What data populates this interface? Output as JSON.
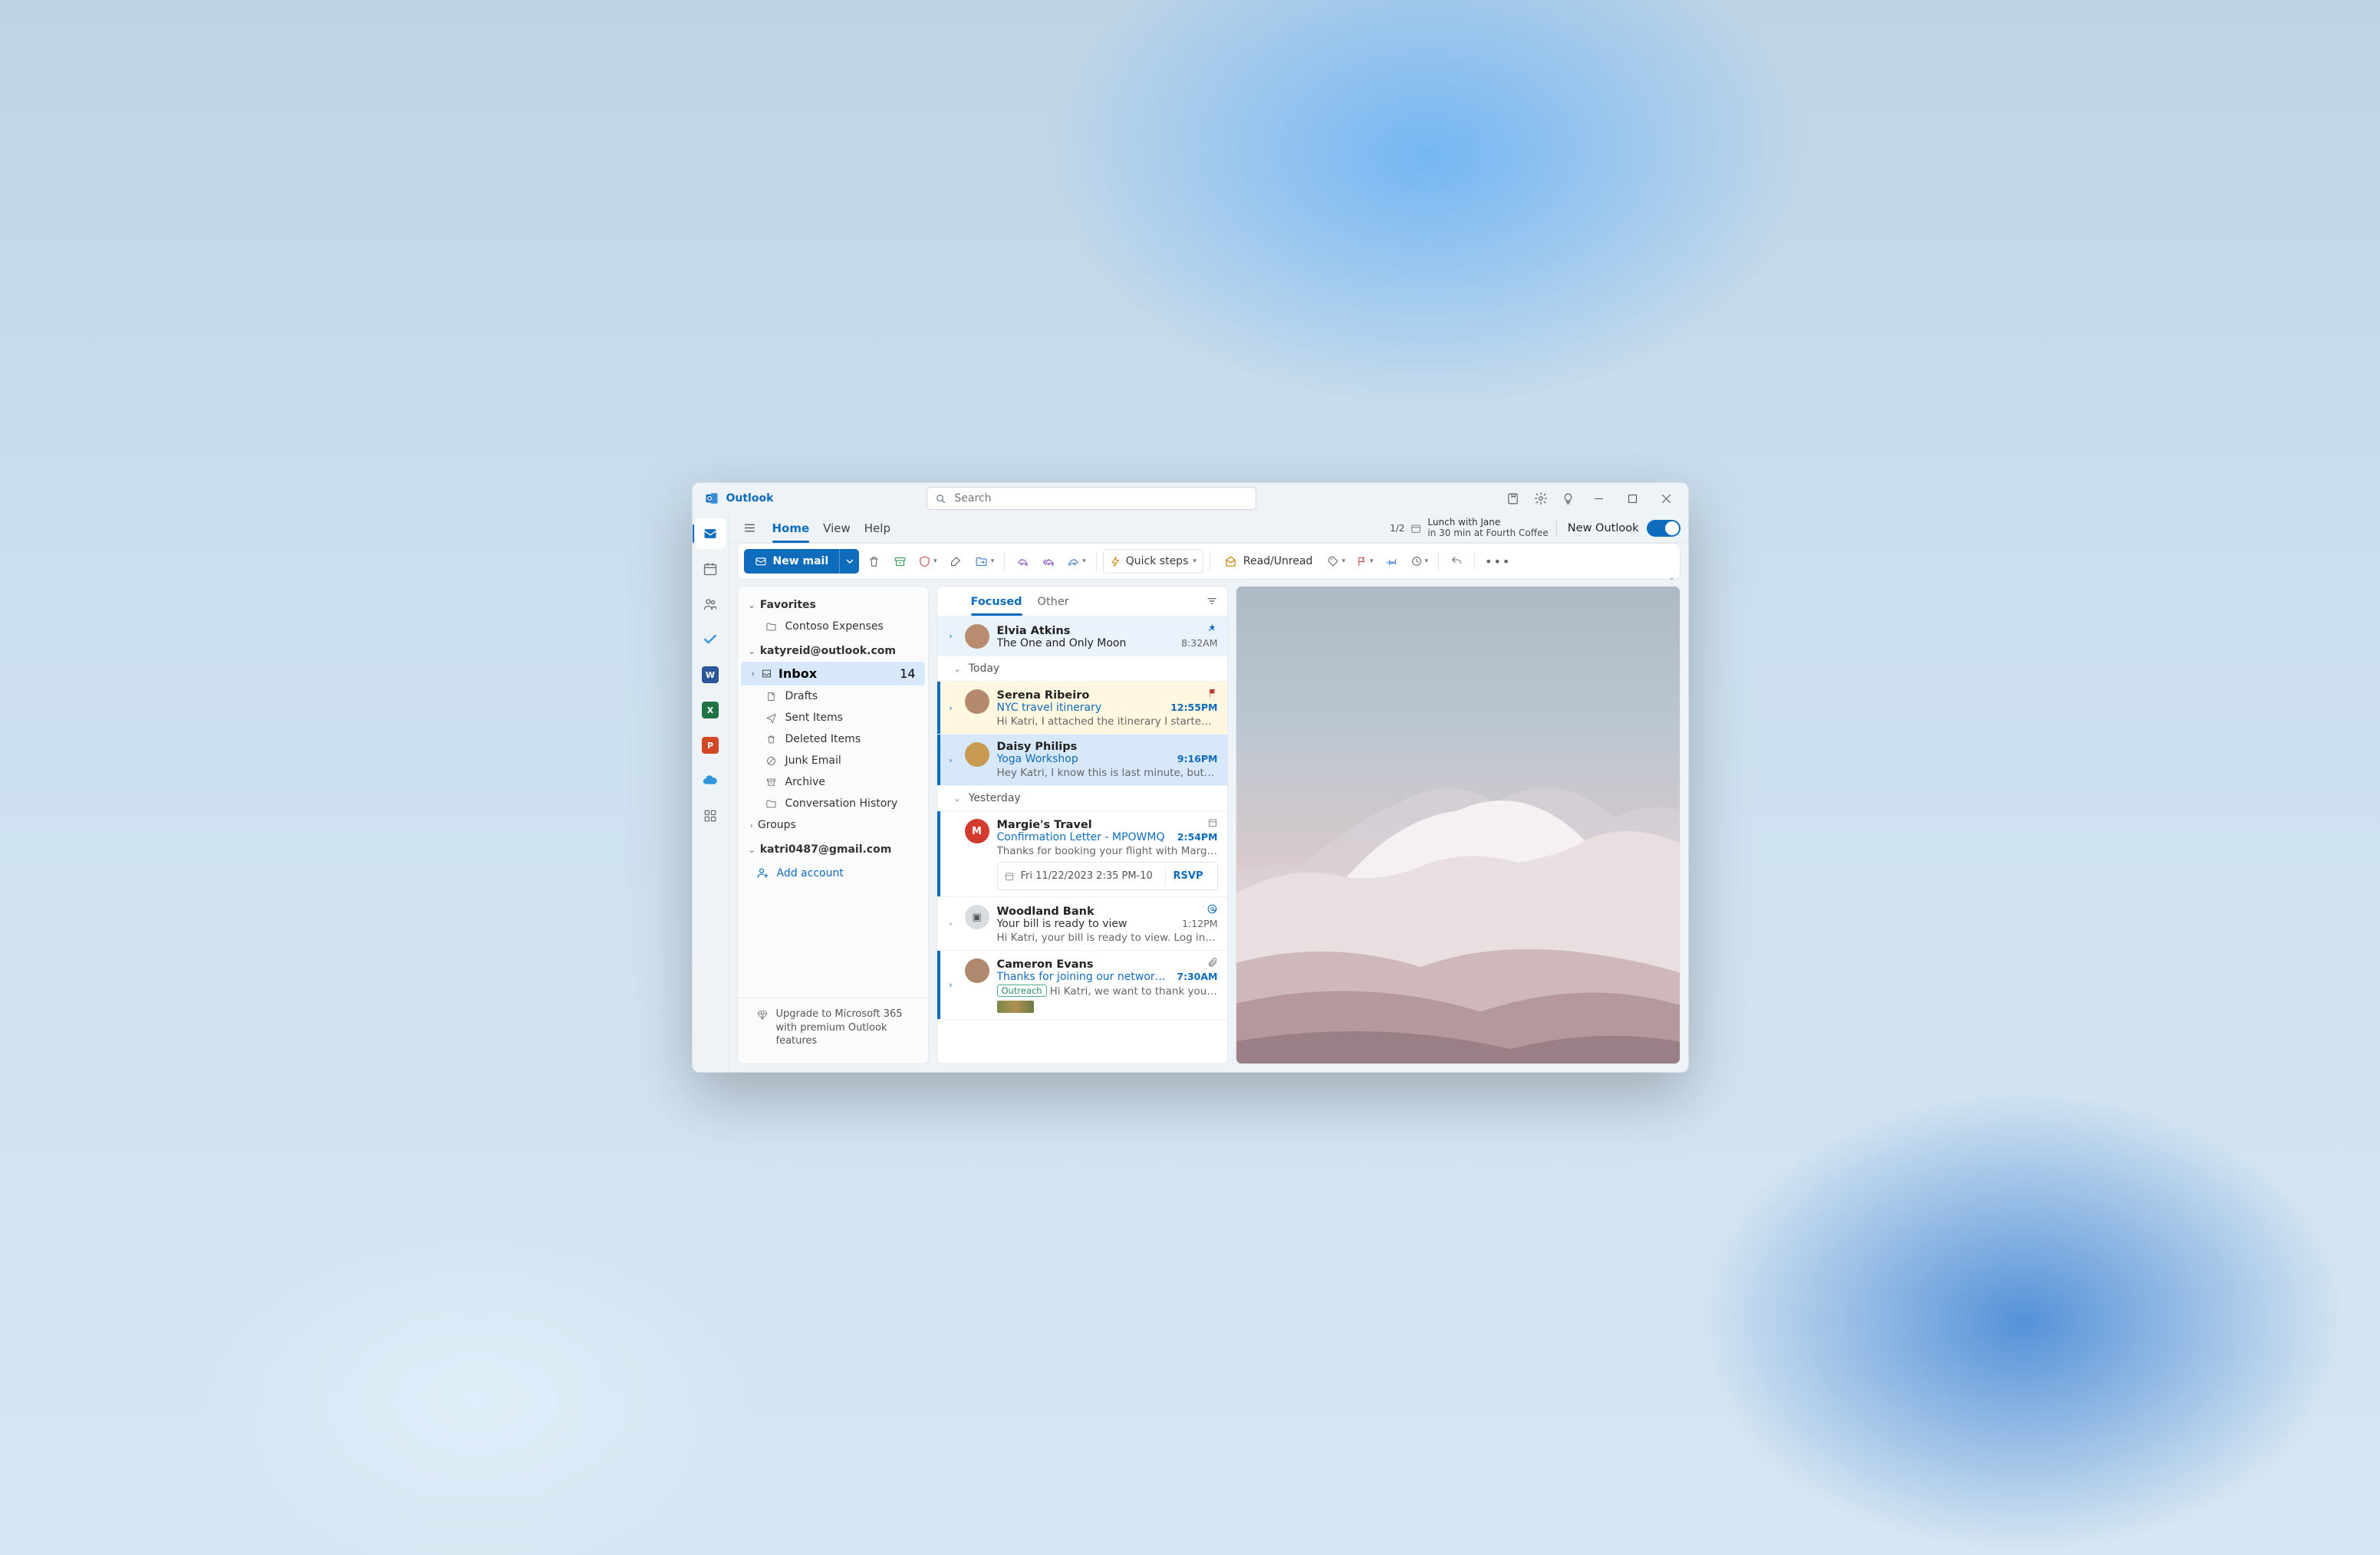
{
  "app": {
    "name": "Outlook"
  },
  "search": {
    "placeholder": "Search"
  },
  "menu": {
    "tabs": [
      "Home",
      "View",
      "Help"
    ],
    "active": 0
  },
  "reminder": {
    "count": "1/2",
    "title": "Lunch with Jane",
    "sub": "in 30 min at Fourth Coffee"
  },
  "newOutlook": {
    "label": "New Outlook",
    "on": true
  },
  "ribbon": {
    "newMail": "New mail",
    "quickSteps": "Quick steps",
    "readUnread": "Read/Unread"
  },
  "folders": {
    "favorites": {
      "label": "Favorites",
      "items": [
        {
          "name": "Contoso Expenses",
          "icon": "folder"
        }
      ]
    },
    "accounts": [
      {
        "email": "katyreid@outlook.com",
        "expanded": true,
        "items": [
          {
            "name": "Inbox",
            "icon": "inbox",
            "count": 14,
            "selected": true,
            "expandable": true
          },
          {
            "name": "Drafts",
            "icon": "draft"
          },
          {
            "name": "Sent Items",
            "icon": "sent"
          },
          {
            "name": "Deleted Items",
            "icon": "trash"
          },
          {
            "name": "Junk Email",
            "icon": "junk"
          },
          {
            "name": "Archive",
            "icon": "archive"
          },
          {
            "name": "Conversation History",
            "icon": "folder"
          }
        ],
        "groups": {
          "label": "Groups"
        }
      },
      {
        "email": "katri0487@gmail.com",
        "expanded": true,
        "items": []
      }
    ],
    "addAccount": "Add account",
    "upgrade": "Upgrade to Microsoft 365 with premium Outlook features"
  },
  "messageList": {
    "tabs": {
      "focused": "Focused",
      "other": "Other",
      "active": "focused"
    },
    "pinned": [
      {
        "from": "Elvia Atkins",
        "subject": "The One and Only Moon",
        "time": "8:32AM",
        "avatar": "#b98c6f"
      }
    ],
    "groups": [
      {
        "label": "Today",
        "items": [
          {
            "from": "Serena Ribeiro",
            "subject": "NYC travel itinerary",
            "time": "12:55PM",
            "preview": "Hi Katri, I attached the itinerary I started fo…",
            "unread": true,
            "flagged": true,
            "avatar": "#b48a6f",
            "expandable": true
          },
          {
            "from": "Daisy Philips",
            "subject": "Yoga Workshop",
            "time": "9:16PM",
            "preview": "Hey Katri, I know this is last minute, but do…",
            "unread": true,
            "selected": true,
            "avatar": "#c89a52",
            "expandable": true
          }
        ]
      },
      {
        "label": "Yesterday",
        "items": [
          {
            "from": "Margie's Travel",
            "subject": "Confirmation Letter - MPOWMQ",
            "time": "2:54PM",
            "preview": "Thanks for booking your flight with Margi…",
            "unread": true,
            "avatarType": "brand-red",
            "avatarText": "M",
            "rightIcon": "calendar",
            "rsvp": {
              "date": "Fri 11/22/2023 2:35 PM-10",
              "button": "RSVP"
            }
          },
          {
            "from": "Woodland Bank",
            "subject": "Your bill is ready to view",
            "time": "1:12PM",
            "preview": "Hi Katri, your bill is ready to view. Log in to…",
            "avatar": "#dadde0",
            "avatarDark": true,
            "rightIcon": "mention",
            "expandable": true
          },
          {
            "from": "Cameron Evans",
            "subject": "Thanks for joining our networking…",
            "time": "7:30AM",
            "preview": "Hi Katri, we want to thank you f…",
            "unread": true,
            "avatar": "#b0886e",
            "rightIcon": "attach",
            "tag": "Outreach",
            "expandable": true,
            "thumb": true
          }
        ]
      }
    ]
  }
}
